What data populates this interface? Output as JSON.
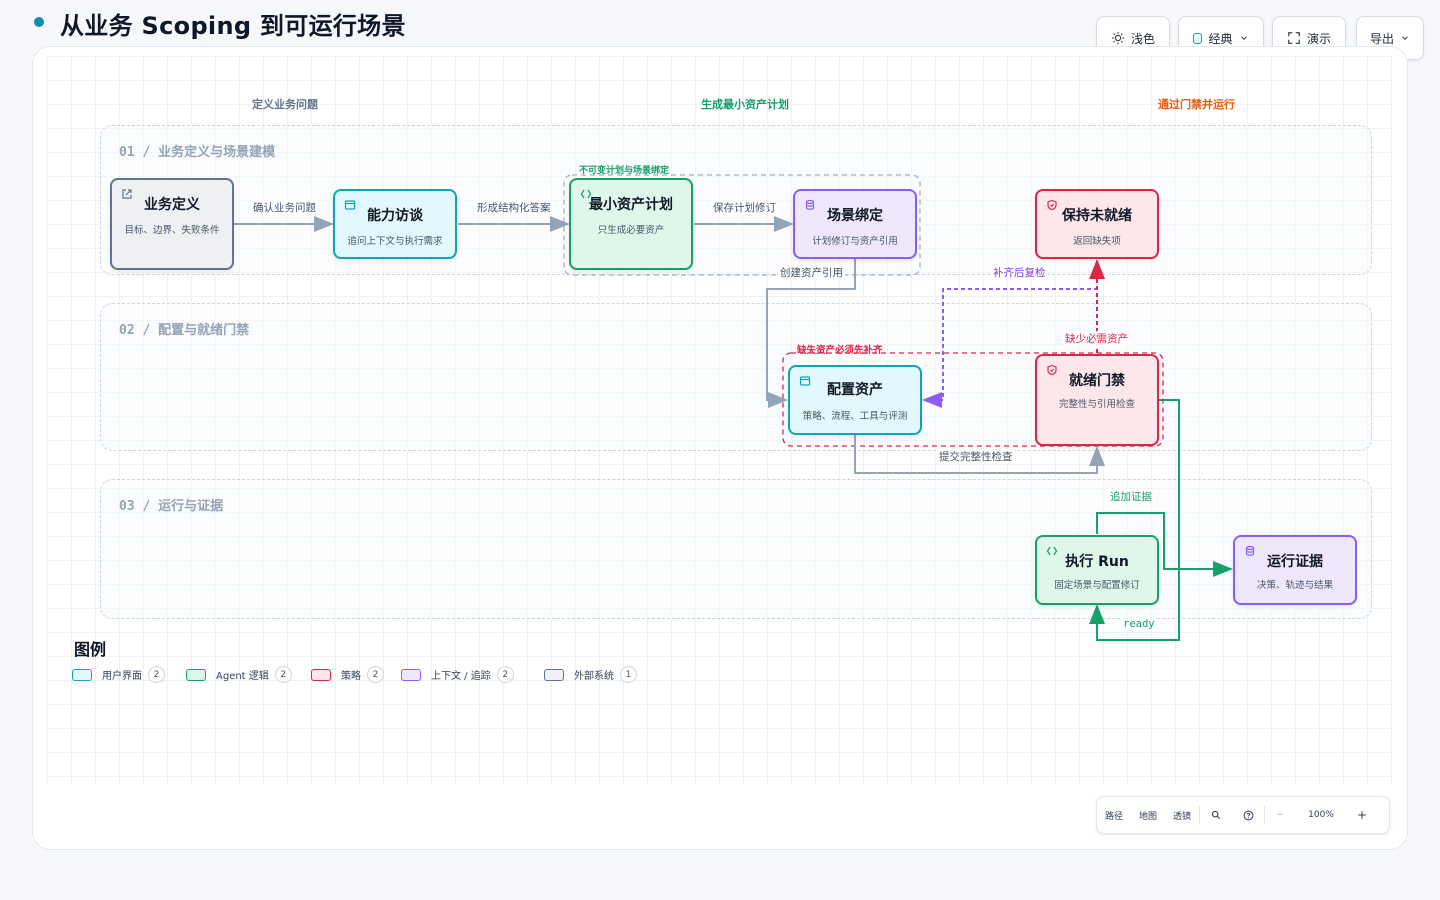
{
  "title": "从业务 Scoping 到可运行场景",
  "toolbar": {
    "theme_label": "浅色",
    "style_label": "经典",
    "present_label": "演示",
    "export_label": "导出"
  },
  "phases": [
    "定义业务问题",
    "生成最小资产计划",
    "通过门禁并运行"
  ],
  "lanes": [
    "01 / 业务定义与场景建模",
    "02 / 配置与就绪门禁",
    "03 / 运行与证据"
  ],
  "nodes": {
    "biz": {
      "title": "业务定义",
      "sub": "目标、边界、失败条件"
    },
    "interview": {
      "title": "能力访谈",
      "sub": "追问上下文与执行需求"
    },
    "plan": {
      "title": "最小资产计划",
      "sub": "只生成必要资产",
      "group_label": "不可变计划与场景绑定"
    },
    "bind": {
      "title": "场景绑定",
      "sub": "计划修订与资产引用"
    },
    "hold": {
      "title": "保持未就绪",
      "sub": "返回缺失项"
    },
    "config": {
      "title": "配置资产",
      "sub": "策略、流程、工具与评测",
      "group_label": "缺失资产必须先补齐"
    },
    "gate": {
      "title": "就绪门禁",
      "sub": "完整性与引用检查"
    },
    "run": {
      "title": "执行 Run",
      "sub": "固定场景与配置修订"
    },
    "evidence": {
      "title": "运行证据",
      "sub": "决策、轨迹与结果"
    }
  },
  "edges": {
    "confirm": "确认业务问题",
    "structure": "形成结构化答案",
    "save_rev": "保存计划修订",
    "create_ref": "创建资产引用",
    "recheck": "补齐后复检",
    "missing": "缺少必需资产",
    "submit": "提交完整性检查",
    "append": "追加证据",
    "ready": "ready"
  },
  "legend": {
    "title": "图例",
    "items": [
      {
        "label": "用户界面",
        "count": "2",
        "color": "#0ea5b7",
        "fill": "#e3f8fc"
      },
      {
        "label": "Agent 逻辑",
        "count": "2",
        "color": "#16a06a",
        "fill": "#dff7ea"
      },
      {
        "label": "策略",
        "count": "2",
        "color": "#dc2647",
        "fill": "#fde7ea"
      },
      {
        "label": "上下文 / 追踪",
        "count": "2",
        "color": "#8b5cf6",
        "fill": "#efe8fd"
      },
      {
        "label": "外部系统",
        "count": "1",
        "color": "#64748b",
        "fill": "#eef0f4"
      }
    ]
  },
  "zoom": {
    "path": "路径",
    "map": "地图",
    "lens": "透镜",
    "level": "100%",
    "minus": "−",
    "plus": "+"
  },
  "colors": {
    "accent": "#0e8fb0",
    "gray_edge": "#94a3b8",
    "green_edge": "#16a06a",
    "red_edge": "#dc2647",
    "purple_edge": "#8b5cf6"
  }
}
